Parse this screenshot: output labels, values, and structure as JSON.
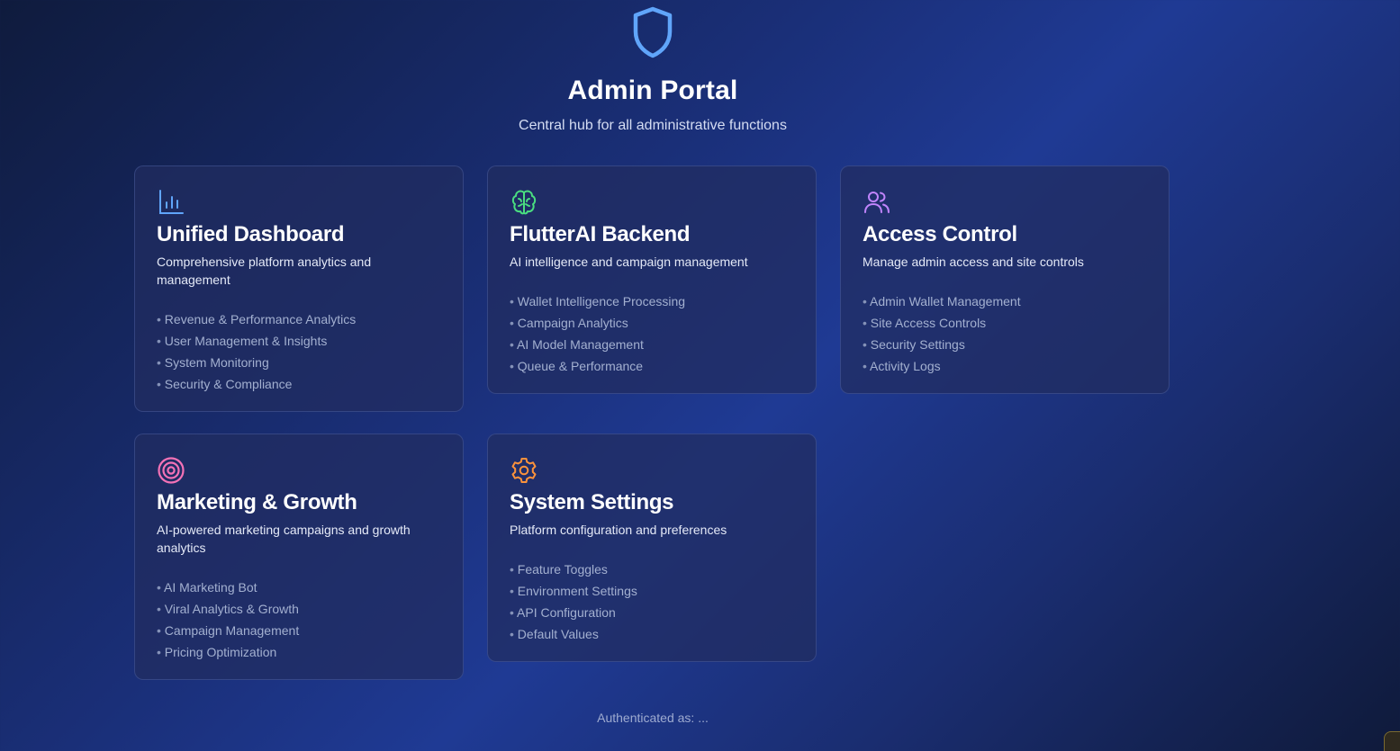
{
  "header": {
    "icon": "shield-icon",
    "title": "Admin Portal",
    "subtitle": "Central hub for all administrative functions"
  },
  "colors": {
    "shield": "#60a5fa",
    "dashboard": "#60a5fa",
    "flutterai": "#4ade80",
    "access": "#c084fc",
    "marketing": "#f472b6",
    "settings": "#fb923c"
  },
  "cards": [
    {
      "icon": "bar-chart-icon",
      "title": "Unified Dashboard",
      "description": "Comprehensive platform analytics and management",
      "features": [
        "Revenue & Performance Analytics",
        "User Management & Insights",
        "System Monitoring",
        "Security & Compliance"
      ]
    },
    {
      "icon": "brain-icon",
      "title": "FlutterAI Backend",
      "description": "AI intelligence and campaign management",
      "features": [
        "Wallet Intelligence Processing",
        "Campaign Analytics",
        "AI Model Management",
        "Queue & Performance"
      ]
    },
    {
      "icon": "users-icon",
      "title": "Access Control",
      "description": "Manage admin access and site controls",
      "features": [
        "Admin Wallet Management",
        "Site Access Controls",
        "Security Settings",
        "Activity Logs"
      ]
    },
    {
      "icon": "target-icon",
      "title": "Marketing & Growth",
      "description": "AI-powered marketing campaigns and growth analytics",
      "features": [
        "AI Marketing Bot",
        "Viral Analytics & Growth",
        "Campaign Management",
        "Pricing Optimization"
      ]
    },
    {
      "icon": "gear-icon",
      "title": "System Settings",
      "description": "Platform configuration and preferences",
      "features": [
        "Feature Toggles",
        "Environment Settings",
        "API Configuration",
        "Default Values"
      ]
    }
  ],
  "footer": {
    "text": "Authenticated as: ..."
  }
}
